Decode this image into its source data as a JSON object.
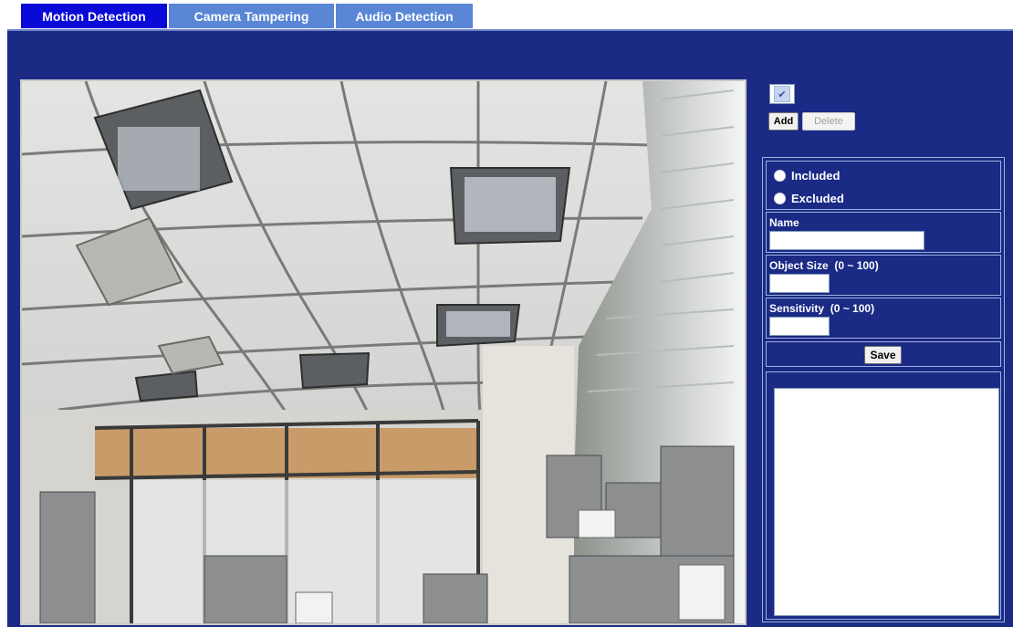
{
  "tabs": [
    {
      "label": "Motion Detection",
      "active": true
    },
    {
      "label": "Camera Tampering",
      "active": false
    },
    {
      "label": "Audio Detection",
      "active": false
    }
  ],
  "controls": {
    "window_select_value": "",
    "add_label": "Add",
    "delete_label": "Delete"
  },
  "form": {
    "included_label": "Included",
    "excluded_label": "Excluded",
    "name_label": "Name",
    "name_value": "",
    "object_size_label": "Object Size",
    "object_size_range": "(0 ~ 100)",
    "object_size_value": "",
    "sensitivity_label": "Sensitivity",
    "sensitivity_range": "(0 ~ 100)",
    "sensitivity_value": "",
    "save_label": "Save",
    "notes_value": ""
  },
  "colors": {
    "panel_bg": "#1a2a85",
    "active_tab": "#0a0ad8",
    "inactive_tab": "#5a86d6"
  },
  "icons": [
    "chevron-down-icon",
    "radio-icon"
  ]
}
